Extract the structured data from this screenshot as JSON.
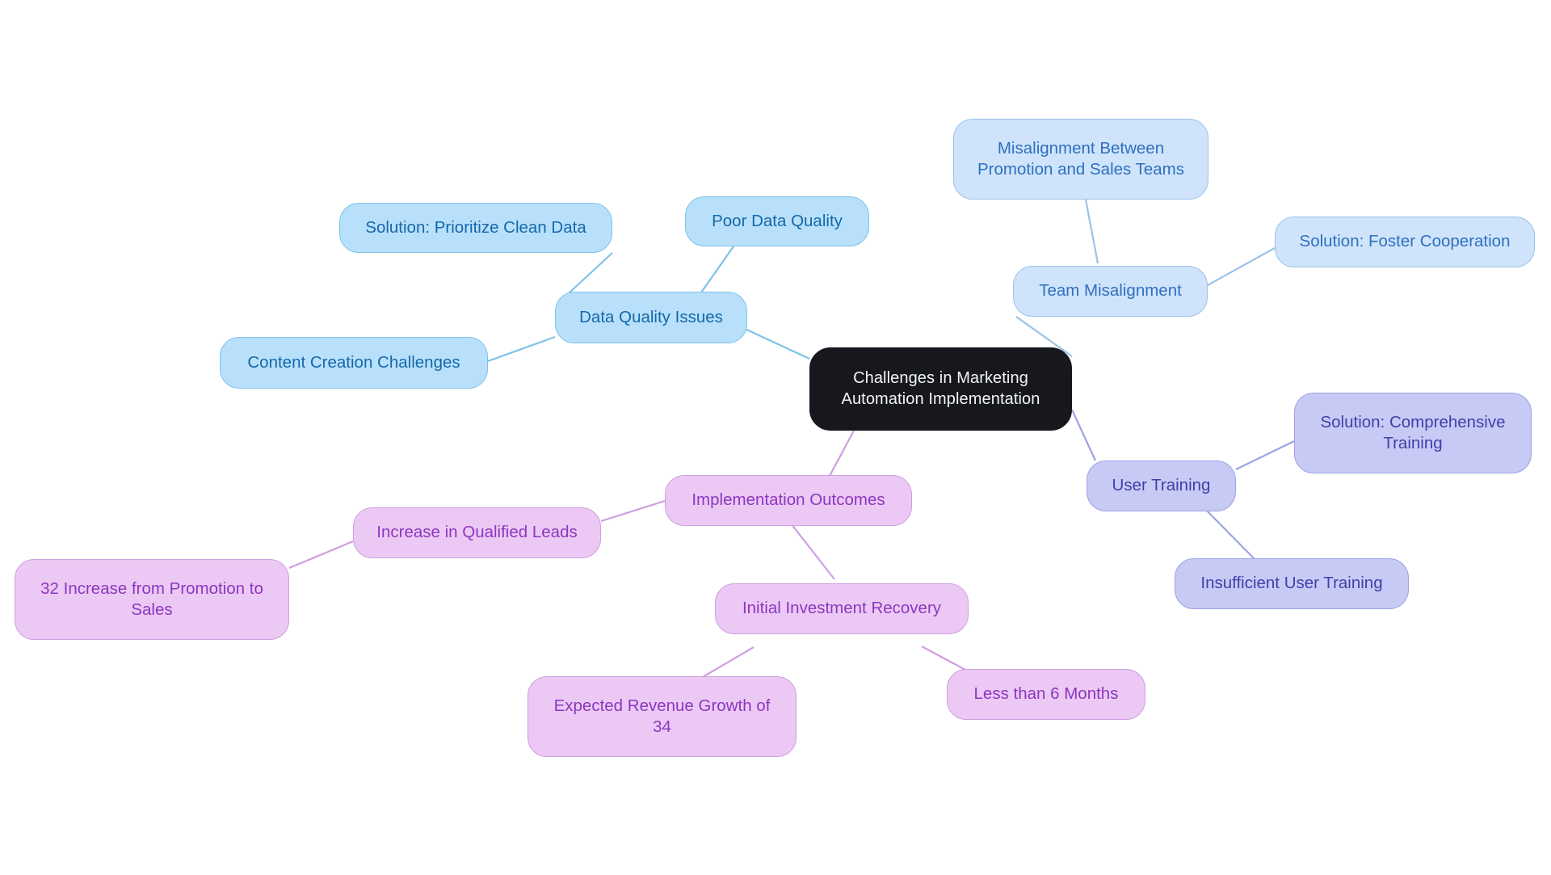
{
  "diagram": {
    "type": "mindmap",
    "title": "Challenges in Marketing Automation Implementation",
    "background_color": "#ffffff",
    "palette": {
      "root_fill": "#16181d",
      "root_text": "#f2f4f7",
      "blue_fill": "#b8e0fb",
      "blue_text": "#1668a8",
      "blue_edge": "#7ec2ea",
      "blue2_fill": "#cfe4fb",
      "blue2_text": "#2f6fbe",
      "blue2_edge": "#9cc2e8",
      "periwinkle_fill": "#c7caf5",
      "periwinkle_text": "#3f3fa8",
      "periwinkle_edge": "#9da3e4",
      "pink_fill": "#ebc9f4",
      "pink_text": "#8d36c0",
      "pink_edge": "#cf9ee0"
    }
  },
  "nodes": {
    "root": {
      "label": "Challenges in Marketing\nAutomation Implementation"
    },
    "data_quality_issues": {
      "label": "Data Quality Issues"
    },
    "solution_prioritize_clean_data": {
      "label": "Solution: Prioritize Clean Data"
    },
    "poor_data_quality": {
      "label": "Poor Data Quality"
    },
    "content_creation_challenges": {
      "label": "Content Creation Challenges"
    },
    "team_misalignment": {
      "label": "Team Misalignment"
    },
    "misalignment_promotion_sales": {
      "label": "Misalignment Between\nPromotion and Sales Teams"
    },
    "solution_foster_cooperation": {
      "label": "Solution: Foster Cooperation"
    },
    "user_training": {
      "label": "User Training"
    },
    "solution_comprehensive_training": {
      "label": "Solution: Comprehensive\nTraining"
    },
    "insufficient_user_training": {
      "label": "Insufficient User Training"
    },
    "implementation_outcomes": {
      "label": "Implementation Outcomes"
    },
    "increase_in_qualified_leads": {
      "label": "Increase in Qualified Leads"
    },
    "increase_promotion_to_sales": {
      "label": "32 Increase from Promotion to\nSales"
    },
    "initial_investment_recovery": {
      "label": "Initial Investment Recovery"
    },
    "expected_revenue_growth": {
      "label": "Expected Revenue Growth of\n34"
    },
    "less_than_6_months": {
      "label": "Less than 6 Months"
    }
  },
  "edges": [
    {
      "from": "root",
      "to": "data_quality_issues"
    },
    {
      "from": "data_quality_issues",
      "to": "solution_prioritize_clean_data"
    },
    {
      "from": "data_quality_issues",
      "to": "poor_data_quality"
    },
    {
      "from": "data_quality_issues",
      "to": "content_creation_challenges"
    },
    {
      "from": "root",
      "to": "team_misalignment"
    },
    {
      "from": "team_misalignment",
      "to": "misalignment_promotion_sales"
    },
    {
      "from": "team_misalignment",
      "to": "solution_foster_cooperation"
    },
    {
      "from": "root",
      "to": "user_training"
    },
    {
      "from": "user_training",
      "to": "solution_comprehensive_training"
    },
    {
      "from": "user_training",
      "to": "insufficient_user_training"
    },
    {
      "from": "root",
      "to": "implementation_outcomes"
    },
    {
      "from": "implementation_outcomes",
      "to": "increase_in_qualified_leads"
    },
    {
      "from": "increase_in_qualified_leads",
      "to": "increase_promotion_to_sales"
    },
    {
      "from": "implementation_outcomes",
      "to": "initial_investment_recovery"
    },
    {
      "from": "initial_investment_recovery",
      "to": "expected_revenue_growth"
    },
    {
      "from": "initial_investment_recovery",
      "to": "less_than_6_months"
    }
  ]
}
